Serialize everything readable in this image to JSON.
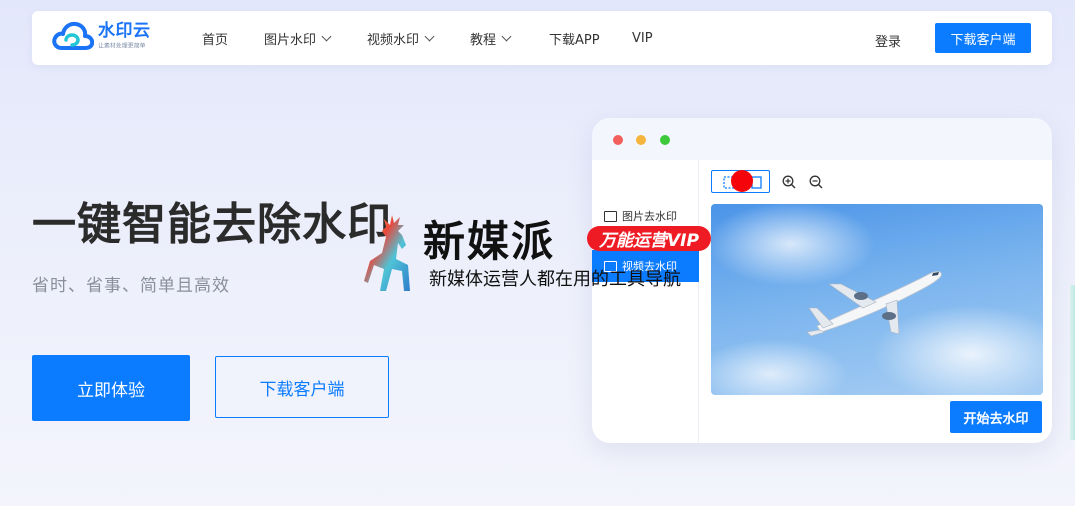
{
  "nav": {
    "logo_name": "水印云",
    "logo_slogan": "让素材处理更简单",
    "menu": [
      {
        "label": "首页",
        "dropdown": false
      },
      {
        "label": "图片水印",
        "dropdown": true
      },
      {
        "label": "视频水印",
        "dropdown": true
      },
      {
        "label": "教程",
        "dropdown": true
      },
      {
        "label": "下载APP",
        "dropdown": false
      },
      {
        "label": "VIP",
        "dropdown": false
      }
    ],
    "login": "登录",
    "download_button": "下载客户端"
  },
  "hero": {
    "title": "一键智能去除水印",
    "subtitle": "省时、省事、简单且高效",
    "try_button": "立即体验",
    "download_button": "下载客户端"
  },
  "app_preview": {
    "traffic_lights": [
      "#f25f5c",
      "#f5b53d",
      "#3ec93b"
    ],
    "sidebar": [
      {
        "label": "图片去水印",
        "active": false,
        "icon": "image-icon"
      },
      {
        "label": "视频去水印",
        "active": true,
        "icon": "video-icon"
      }
    ],
    "toolbar_icons": [
      "selection-tool-icon",
      "zoom-in-icon",
      "zoom-out-icon"
    ],
    "image": "airplane-in-cloudy-sky",
    "start_button": "开始去水印"
  },
  "overlay": {
    "title": "新媒派",
    "badge": "万能运营VIP",
    "subtitle": "新媒体运营人都在用的工具导航"
  },
  "colors": {
    "primary": "#0b7cff",
    "badge_red": "#ee1b24",
    "marker_red": "#f5050b",
    "text_dark": "#2b2b2b",
    "text_muted": "#8a8f9c"
  }
}
